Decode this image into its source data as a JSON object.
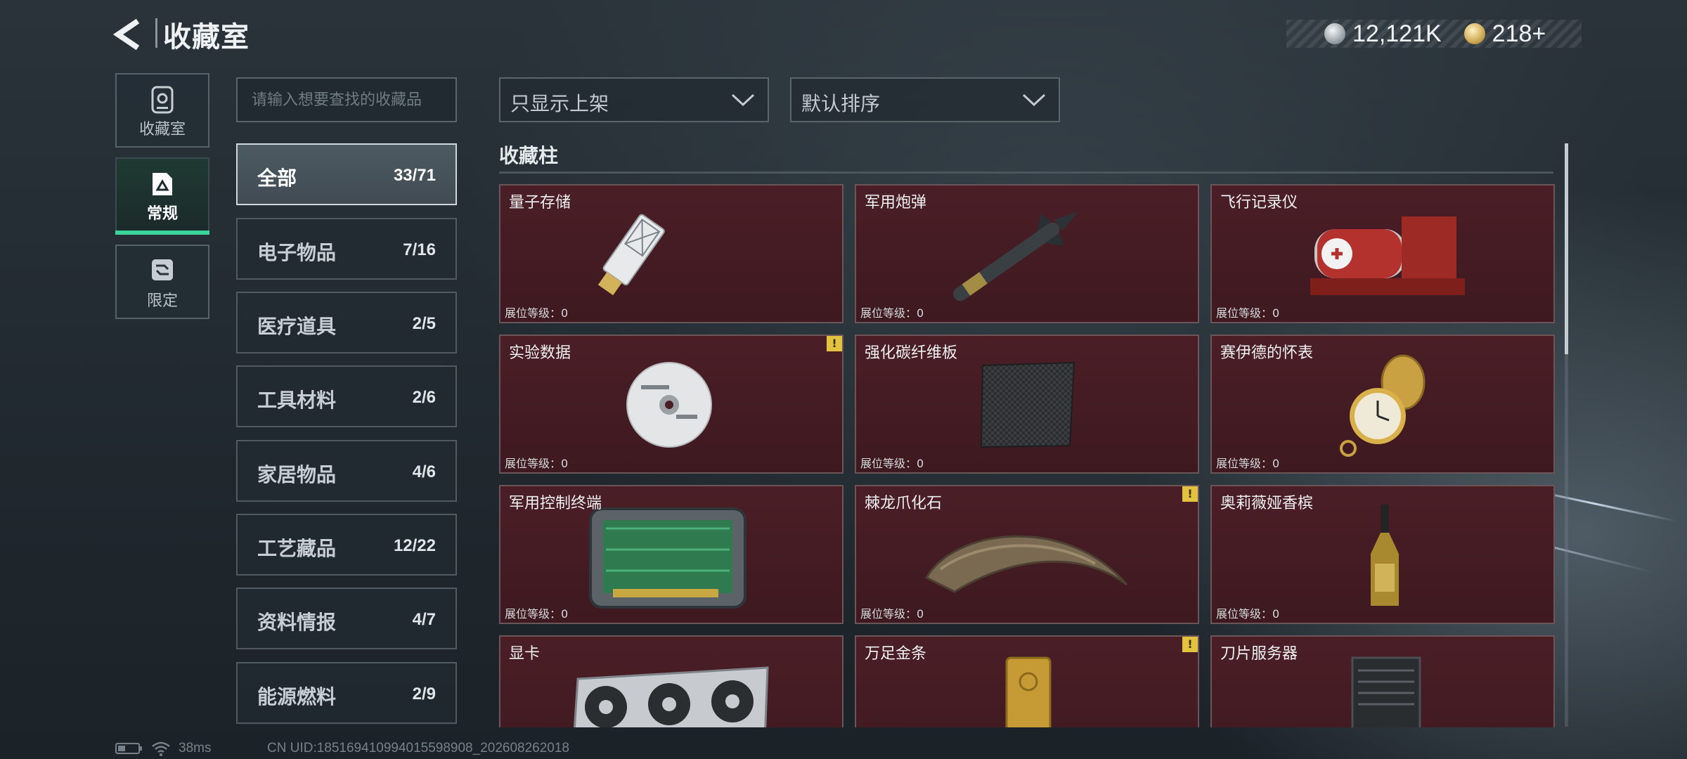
{
  "header": {
    "title": "收藏室"
  },
  "currency": [
    {
      "icon": "silver-coin-icon",
      "value": "12,121K"
    },
    {
      "icon": "gold-coin-icon",
      "value": "218+"
    }
  ],
  "mode_tabs": [
    {
      "label": "收藏室",
      "icon": "collection-room-icon"
    },
    {
      "label": "常规",
      "icon": "regular-icon",
      "active": true
    },
    {
      "label": "限定",
      "icon": "limited-icon"
    }
  ],
  "search": {
    "placeholder": "请输入想要查找的收藏品"
  },
  "categories": [
    {
      "name": "全部",
      "count": "33/71",
      "active": true
    },
    {
      "name": "电子物品",
      "count": "7/16"
    },
    {
      "name": "医疗道具",
      "count": "2/5"
    },
    {
      "name": "工具材料",
      "count": "2/6"
    },
    {
      "name": "家居物品",
      "count": "4/6"
    },
    {
      "name": "工艺藏品",
      "count": "12/22"
    },
    {
      "name": "资料情报",
      "count": "4/7"
    },
    {
      "name": "能源燃料",
      "count": "2/9"
    }
  ],
  "filters": {
    "display": "只显示上架",
    "sort": "默认排序"
  },
  "cabinet": {
    "title": "收藏柱",
    "level_label": "展位等级：",
    "items": [
      {
        "name": "量子存储",
        "level": "0",
        "icon": "usb-drive-icon",
        "alert": false
      },
      {
        "name": "军用炮弹",
        "level": "0",
        "icon": "missile-icon",
        "alert": false
      },
      {
        "name": "飞行记录仪",
        "level": "0",
        "icon": "flight-recorder-icon",
        "alert": false
      },
      {
        "name": "实验数据",
        "level": "0",
        "icon": "disc-icon",
        "alert": true
      },
      {
        "name": "强化碳纤维板",
        "level": "0",
        "icon": "carbon-plate-icon",
        "alert": false
      },
      {
        "name": "赛伊德的怀表",
        "level": "0",
        "icon": "pocket-watch-icon",
        "alert": false
      },
      {
        "name": "军用控制终端",
        "level": "0",
        "icon": "control-terminal-icon",
        "alert": false
      },
      {
        "name": "棘龙爪化石",
        "level": "0",
        "icon": "claw-fossil-icon",
        "alert": true
      },
      {
        "name": "奥莉薇娅香槟",
        "level": "0",
        "icon": "champagne-bottle-icon",
        "alert": false
      },
      {
        "name": "显卡",
        "level": "",
        "icon": "graphics-card-icon",
        "alert": false
      },
      {
        "name": "万足金条",
        "level": "",
        "icon": "gold-bar-icon",
        "alert": true
      },
      {
        "name": "刀片服务器",
        "level": "",
        "icon": "blade-server-icon",
        "alert": false
      }
    ]
  },
  "status": {
    "ping": "38ms",
    "uid": "CN UID:185169410994015598908_202608262018"
  },
  "colors": {
    "accent": "#3bd49a",
    "card_bg": "#4b1e26",
    "alert": "#e2c23f"
  }
}
